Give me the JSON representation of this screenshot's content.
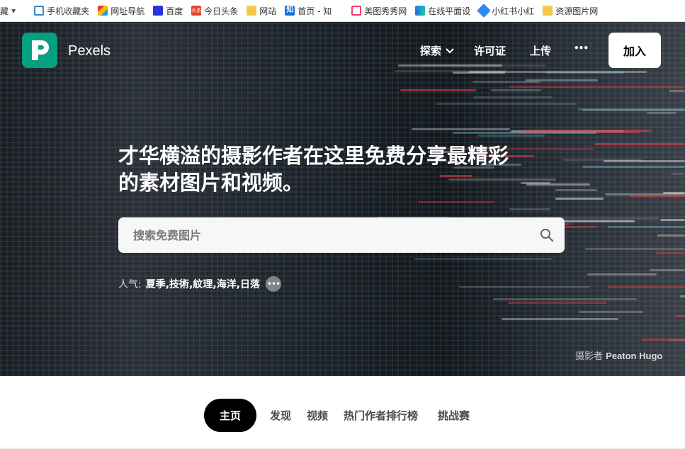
{
  "bookmarks": {
    "first_label": "藏",
    "items": [
      {
        "label": "手机收藏夹",
        "icon": "phone-icon"
      },
      {
        "label": "网址导航",
        "icon": "home-nav-icon"
      },
      {
        "label": "百度",
        "icon": "baidu-paw-icon"
      },
      {
        "label": "今日头条",
        "icon": "toutiao-icon",
        "badge": "头条"
      },
      {
        "label": "网站",
        "icon": "folder-icon"
      },
      {
        "label": "首页 - 知",
        "icon": "zhihu-icon",
        "badge": "知"
      },
      {
        "label": "美图秀秀网",
        "icon": "meitu-icon"
      },
      {
        "label": "在线平面设",
        "icon": "edge-icon"
      },
      {
        "label": "小红书小红",
        "icon": "drop-icon"
      },
      {
        "label": "资源图片网",
        "icon": "folder-icon"
      }
    ]
  },
  "header": {
    "brand": "Pexels",
    "nav": {
      "explore": "探索",
      "license": "许可证",
      "upload": "上传",
      "more": "•••"
    },
    "join_label": "加入"
  },
  "hero": {
    "headline_line1": "才华横溢的摄影作者在这里免费分享最精彩",
    "headline_line2": "的素材图片和视频。",
    "search_placeholder": "搜索免费图片",
    "popular_label": "人气:",
    "popular_tags": [
      "夏季,",
      "技術,",
      "紋理,",
      "海洋,",
      "日落"
    ],
    "more_dots": "•••",
    "credit_prefix": "摄影者",
    "credit_name": "Peaton Hugo"
  },
  "tabs": [
    {
      "label": "主页",
      "active": true
    },
    {
      "label": "发现",
      "active": false
    },
    {
      "label": "视频",
      "active": false
    },
    {
      "label": "热门作者排行榜",
      "active": false
    },
    {
      "label": "挑战赛",
      "active": false
    }
  ],
  "colors": {
    "brand_green": "#05a081",
    "active_tab": "#000000"
  }
}
